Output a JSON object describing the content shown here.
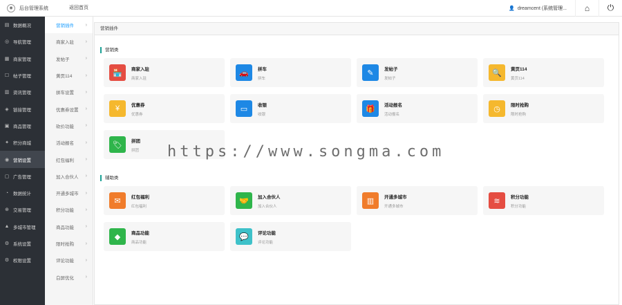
{
  "topbar": {
    "brand_title": "后台管理系统",
    "home_tab": "返回首页",
    "user_label": "dreamcent (系统管理...",
    "home_icon": "home-icon",
    "power_icon": "power-icon"
  },
  "sidebar": {
    "items": [
      {
        "label": "数据概况",
        "icon": "▤",
        "active": false
      },
      {
        "label": "导航管理",
        "icon": "◎",
        "active": false
      },
      {
        "label": "商家管理",
        "icon": "▦",
        "active": false
      },
      {
        "label": "帖子管理",
        "icon": "☐",
        "active": false
      },
      {
        "label": "资讯管理",
        "icon": "▥",
        "active": false
      },
      {
        "label": "链接管理",
        "icon": "◈",
        "active": false
      },
      {
        "label": "商品管理",
        "icon": "▣",
        "active": false
      },
      {
        "label": "积分商城",
        "icon": "✦",
        "active": false
      },
      {
        "label": "营销设置",
        "icon": "◉",
        "active": true
      },
      {
        "label": "广告管理",
        "icon": "▢",
        "active": false
      },
      {
        "label": "数据统计",
        "icon": "◔",
        "active": false
      },
      {
        "label": "交易管理",
        "icon": "⊕",
        "active": false
      },
      {
        "label": "多城市管理",
        "icon": "▲",
        "active": false
      },
      {
        "label": "系统设置",
        "icon": "⚙",
        "active": false
      },
      {
        "label": "权限设置",
        "icon": "⚙",
        "active": false
      }
    ]
  },
  "subbar": {
    "items": [
      {
        "label": "营销插件",
        "active": true
      },
      {
        "label": "商家入驻",
        "active": false
      },
      {
        "label": "发帖子",
        "active": false
      },
      {
        "label": "黄页114",
        "active": false
      },
      {
        "label": "拼车设置",
        "active": false
      },
      {
        "label": "优惠券设置",
        "active": false
      },
      {
        "label": "砍价功能",
        "active": false
      },
      {
        "label": "活动报名",
        "active": false
      },
      {
        "label": "红包福利",
        "active": false
      },
      {
        "label": "加入合伙人",
        "active": false
      },
      {
        "label": "开通多城市",
        "active": false
      },
      {
        "label": "积分功能",
        "active": false
      },
      {
        "label": "商品功能",
        "active": false
      },
      {
        "label": "限时抢购",
        "active": false
      },
      {
        "label": "评论功能",
        "active": false
      },
      {
        "label": "白屏优化",
        "active": false
      }
    ]
  },
  "content": {
    "header": "营销插件",
    "marketing": {
      "title": "营销类",
      "cards": [
        {
          "title": "商家入驻",
          "sub": "商家入驻",
          "color": "#e54d42",
          "glyph": "🏪",
          "icon": "store-icon"
        },
        {
          "title": "拼车",
          "sub": "拼车",
          "color": "#1e88e5",
          "glyph": "🚗",
          "icon": "car-icon"
        },
        {
          "title": "发帖子",
          "sub": "发帖子",
          "color": "#1e88e5",
          "glyph": "✎",
          "icon": "post-icon"
        },
        {
          "title": "黄页114",
          "sub": "黄页114",
          "color": "#f5b82e",
          "glyph": "🔍",
          "icon": "yellow-pages-icon"
        },
        {
          "title": "优惠券",
          "sub": "优惠券",
          "color": "#f5b82e",
          "glyph": "¥",
          "icon": "coupon-icon"
        },
        {
          "title": "收银",
          "sub": "收银",
          "color": "#1e88e5",
          "glyph": "▭",
          "icon": "wallet-icon"
        },
        {
          "title": "活动报名",
          "sub": "活动报名",
          "color": "#1e88e5",
          "glyph": "🎁",
          "icon": "gift-icon"
        },
        {
          "title": "限时抢购",
          "sub": "限时抢购",
          "color": "#f5b82e",
          "glyph": "◷",
          "icon": "clock-icon"
        },
        {
          "title": "拼团",
          "sub": "拼团",
          "color": "#2fb54b",
          "glyph": "🏷",
          "icon": "tag-icon"
        }
      ]
    },
    "auxiliary": {
      "title": "辅助类",
      "cards": [
        {
          "title": "红包福利",
          "sub": "红包福利",
          "color": "#f07c2b",
          "glyph": "✉",
          "icon": "red-packet-icon"
        },
        {
          "title": "加入合伙人",
          "sub": "加入合伙人",
          "color": "#2fb54b",
          "glyph": "🤝",
          "icon": "handshake-icon"
        },
        {
          "title": "开通多城市",
          "sub": "开通多城市",
          "color": "#f07c2b",
          "glyph": "▥",
          "icon": "city-icon"
        },
        {
          "title": "积分功能",
          "sub": "积分功能",
          "color": "#e54d42",
          "glyph": "≋",
          "icon": "points-icon"
        },
        {
          "title": "商品功能",
          "sub": "商品功能",
          "color": "#2fb54b",
          "glyph": "◆",
          "icon": "box-icon"
        },
        {
          "title": "评论功能",
          "sub": "评论功能",
          "color": "#3ec1c9",
          "glyph": "💬",
          "icon": "comment-icon"
        }
      ]
    }
  },
  "watermark": "https://www.songma.com"
}
